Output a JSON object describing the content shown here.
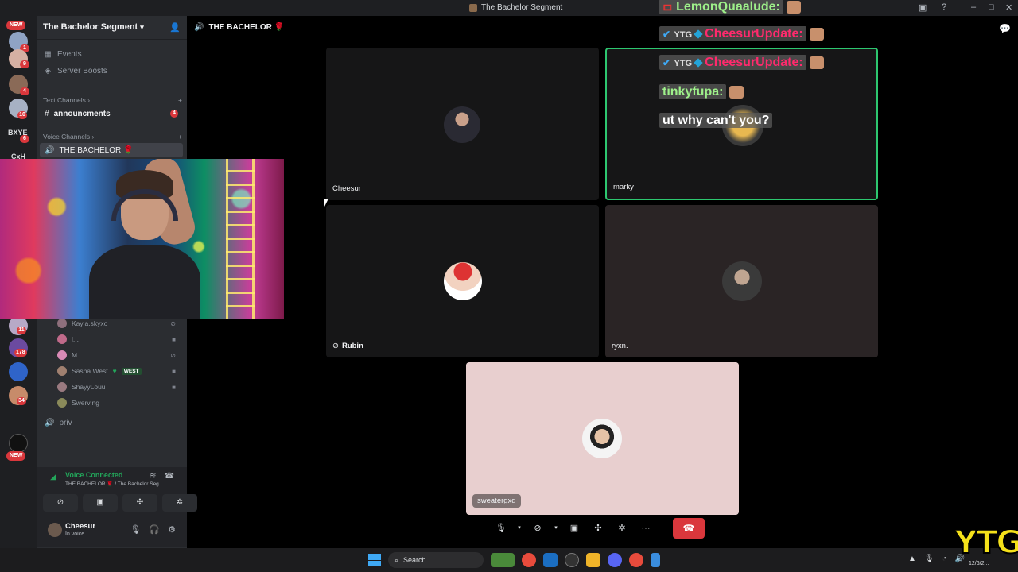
{
  "window": {
    "title": "The Bachelor Segment"
  },
  "rail": {
    "new_badge": "NEW",
    "badges": [
      "1",
      "9",
      "4",
      "10",
      "6",
      "11",
      "178",
      "34"
    ],
    "text_servers": [
      "BXYE",
      "CxH"
    ],
    "bottom_new": "NEW"
  },
  "sidebar": {
    "guild_name": "The Bachelor Segment",
    "events": "Events",
    "server_boosts": "Server Boosts",
    "text_category": "Text Channels",
    "announcements": "announcments",
    "announcements_badge": "4",
    "voice_category": "Voice Channels",
    "bachelor_channel": "THE BACHELOR 🌹",
    "members": [
      {
        "name": "Kayla.skyxo",
        "icon": "mic-off-icon"
      },
      {
        "name": "l...",
        "icon": "video-icon"
      },
      {
        "name": "M...",
        "icon": "mic-off-icon"
      },
      {
        "name": "Sasha West",
        "tag": "WEST",
        "icon": "video-icon"
      },
      {
        "name": "ShayyLouu",
        "icon": "video-icon"
      },
      {
        "name": "Swerving",
        "icon": ""
      }
    ],
    "priv_channel": "priv"
  },
  "voice_panel": {
    "status": "Voice Connected",
    "sub": "THE BACHELOR 🌹 / The Bachelor Seg..."
  },
  "user_panel": {
    "name": "Cheesur",
    "status": "In voice"
  },
  "main": {
    "channel_title": "THE BACHELOR 🌹",
    "tiles": [
      {
        "name": "Cheesur"
      },
      {
        "name": "marky"
      },
      {
        "name": "Rubin"
      },
      {
        "name": "ryxn."
      },
      {
        "name": "sweatergxd"
      }
    ]
  },
  "chat_overlay": [
    {
      "user": "LemonQuaalude:",
      "color": "#9ef08a"
    },
    {
      "user": "CheesurUpdate:",
      "color": "#ff2a6d"
    },
    {
      "user": "CheesurUpdate:",
      "color": "#ff2a6d"
    },
    {
      "user": "tinkyfupa:",
      "color": "#9ef08a"
    },
    {
      "text": "ut why can't you?"
    }
  ],
  "overlay_badge": "YTG",
  "taskbar": {
    "search": "Search",
    "clock": "12/6/2..."
  },
  "watermark": "YTG"
}
